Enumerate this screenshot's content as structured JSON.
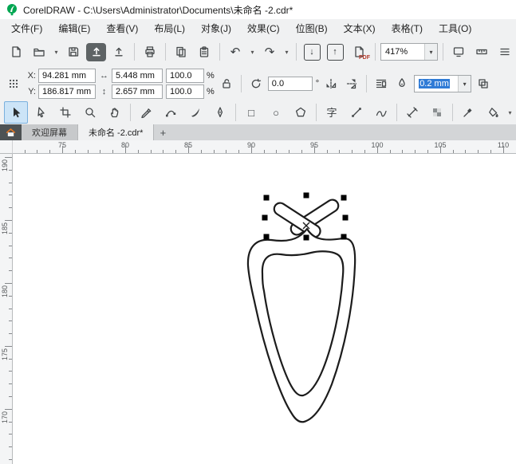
{
  "window": {
    "title": "CorelDRAW - C:\\Users\\Administrator\\Documents\\未命名 -2.cdr*"
  },
  "menu": {
    "items": [
      "文件(F)",
      "编辑(E)",
      "查看(V)",
      "布局(L)",
      "对象(J)",
      "效果(C)",
      "位图(B)",
      "文本(X)",
      "表格(T)",
      "工具(O)"
    ]
  },
  "toolbar": {
    "zoom_value": "417%",
    "pdf_label": "PDF"
  },
  "property_bar": {
    "x_label": "X:",
    "x_value": "94.281 mm",
    "y_label": "Y:",
    "y_value": "186.817 mm",
    "width_value": "5.448 mm",
    "height_value": "2.657 mm",
    "scale_x": "100.0",
    "scale_y": "100.0",
    "percent": "%",
    "rotation_value": "0.0",
    "degree": "°",
    "outline_width": "0.2 mm"
  },
  "tabs": {
    "welcome_label": "欢迎屏幕",
    "document_label": "未命名 -2.cdr*",
    "new_tab_label": "+"
  },
  "rulers": {
    "horizontal": [
      "75",
      "80",
      "85",
      "90",
      "95",
      "100",
      "105",
      "110"
    ],
    "vertical": [
      "190",
      "185",
      "180",
      "175",
      "170"
    ]
  },
  "icons": {
    "dropdown": "▾",
    "undo": "↶",
    "redo": "↷",
    "import_arrow": "↓",
    "export_arrow": "↑",
    "width_arrow": "↔",
    "height_arrow": "↕",
    "rectangle": "□",
    "ellipse": "○",
    "text_tool": "字"
  },
  "colors": {
    "logo_green": "#00a651",
    "selection_blue": "#2f7bd6",
    "ink": "#1c1c1c",
    "chrome": "#f0f1f2"
  }
}
